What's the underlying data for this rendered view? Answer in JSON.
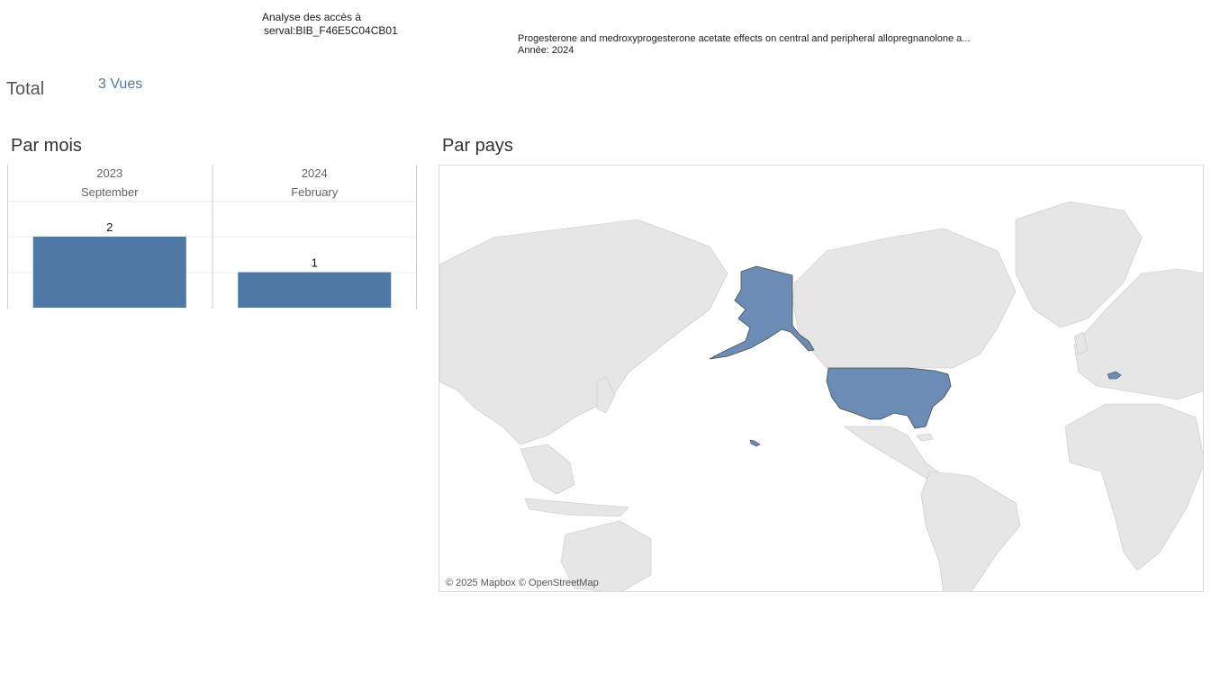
{
  "header": {
    "title_line1": "Analyse des accès à",
    "title_line2": "serval:BIB_F46E5C04CB01"
  },
  "article": {
    "title": "Progesterone and medroxyprogesterone acetate effects on central and peripheral allopregnanolone a...",
    "year_line": "Année: 2024"
  },
  "total": {
    "label": "Total",
    "views": "3 Vues"
  },
  "sections": {
    "by_month": "Par mois",
    "by_country": "Par pays"
  },
  "map": {
    "attribution": "© 2025 Mapbox © OpenStreetMap",
    "highlighted_countries": [
      "United States",
      "Switzerland"
    ],
    "highlight_color": "#6b8db5",
    "base_land_color": "#e6e6e6"
  },
  "chart_data": {
    "type": "bar",
    "categories": [
      {
        "year": "2023",
        "month": "September"
      },
      {
        "year": "2024",
        "month": "February"
      }
    ],
    "values": [
      2,
      1
    ],
    "ylim": [
      0,
      2
    ],
    "bar_color": "#4e79a7",
    "grid": true
  }
}
